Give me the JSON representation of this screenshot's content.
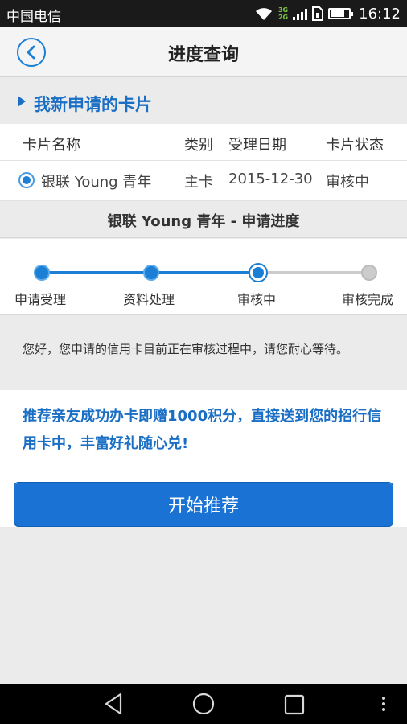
{
  "status_bar": {
    "carrier": "中国电信",
    "network_3g": "3G",
    "network_2g": "2G",
    "time": "16:12",
    "battery_level": 0.75
  },
  "nav": {
    "title": "进度查询",
    "back_icon": "chevron-left-circle"
  },
  "section": {
    "title": "我新申请的卡片"
  },
  "table": {
    "headers": [
      "卡片名称",
      "类别",
      "受理日期",
      "卡片状态"
    ],
    "rows": [
      {
        "name": "银联 Young 青年",
        "type": "主卡",
        "date": "2015-12-30",
        "status": "审核中",
        "selected": true
      }
    ]
  },
  "progress": {
    "title": "银联 Young 青年 - 申请进度",
    "steps": [
      {
        "label": "申请受理",
        "state": "done"
      },
      {
        "label": "资料处理",
        "state": "done"
      },
      {
        "label": "审核中",
        "state": "current"
      },
      {
        "label": "审核完成",
        "state": "pending"
      }
    ],
    "active_color": "#1a7fd5",
    "pending_color": "#cccccc"
  },
  "message": {
    "text": "您好，您申请的信用卡目前正在审核过程中，请您耐心等待。"
  },
  "promo": {
    "text": "推荐亲友成功办卡即赠1000积分，直接送到您的招行信用卡中，丰富好礼随心兑!",
    "button_label": "开始推荐"
  },
  "colors": {
    "accent": "#1a73d4",
    "accent_text": "#1a6fc5"
  }
}
